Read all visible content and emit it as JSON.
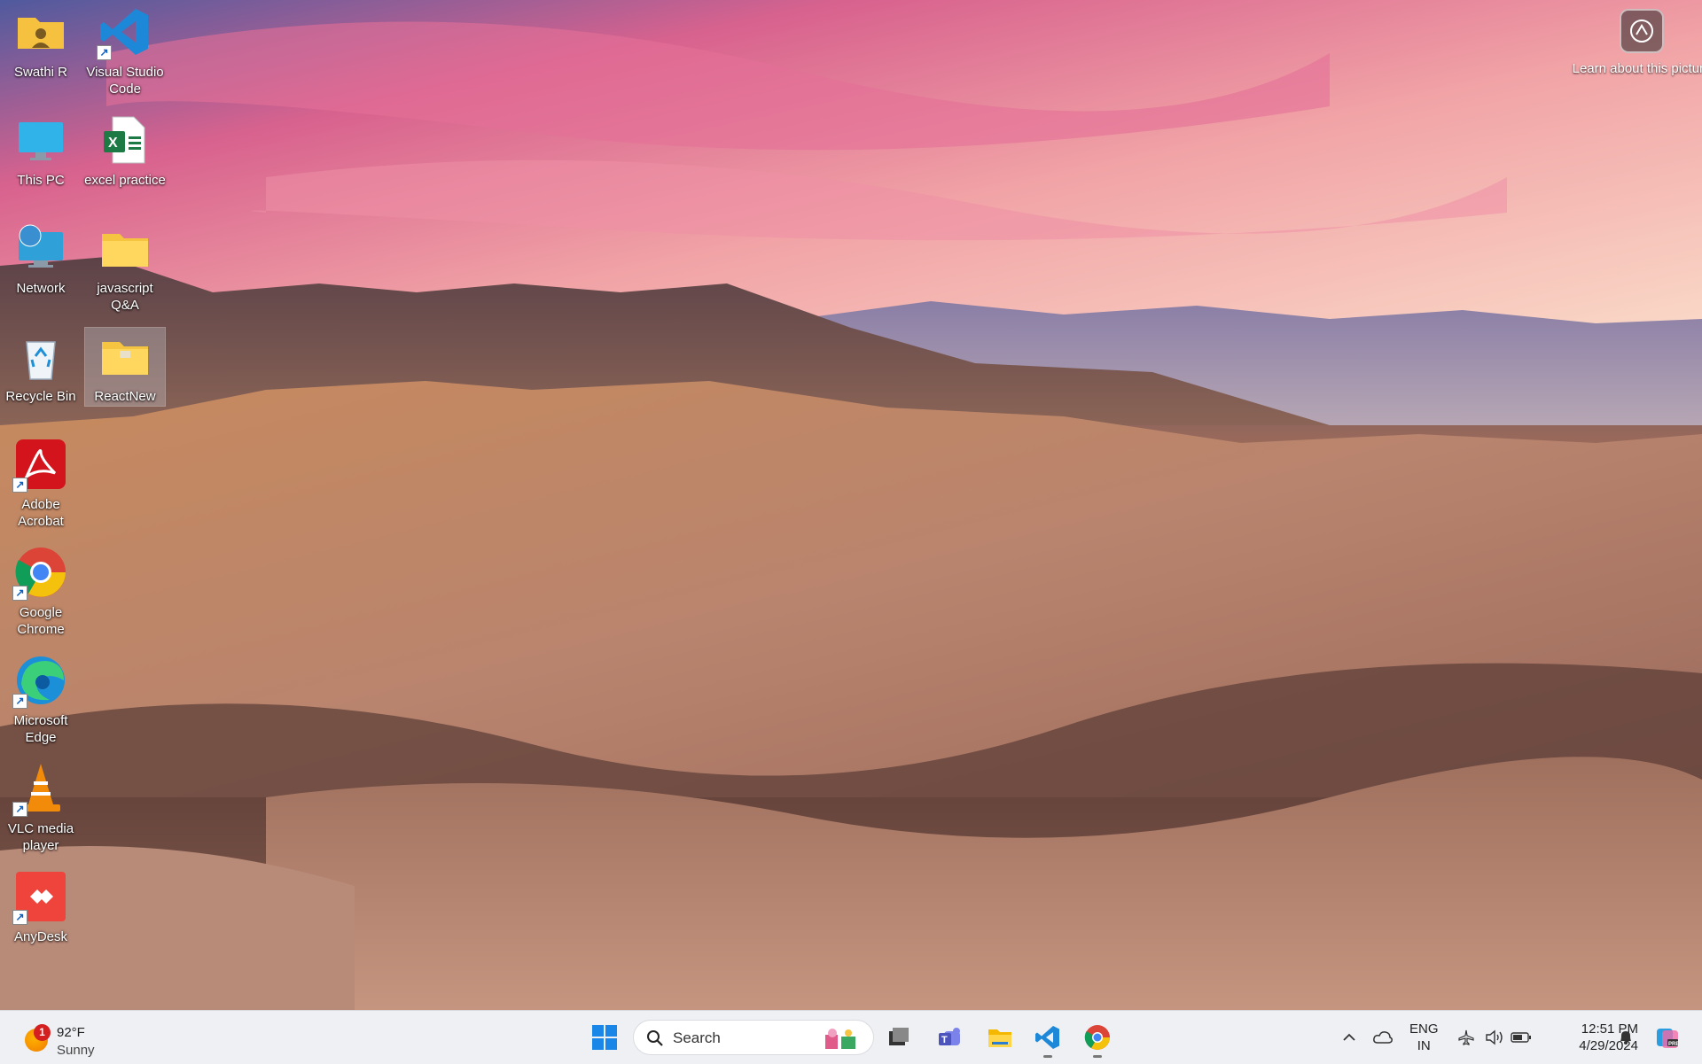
{
  "desktop": {
    "icons": [
      {
        "label": "Swathi R",
        "icon": "user-folder-icon"
      },
      {
        "label": "Visual Studio Code",
        "icon": "vscode-icon"
      },
      {
        "label": "This PC",
        "icon": "monitor-icon"
      },
      {
        "label": "excel practice",
        "icon": "excel-icon"
      },
      {
        "label": "Network",
        "icon": "network-icon"
      },
      {
        "label": "javascript Q&A",
        "icon": "folder-icon"
      },
      {
        "label": "Recycle Bin",
        "icon": "recycle-bin-icon"
      },
      {
        "label": "ReactNew",
        "icon": "folder-icon"
      },
      {
        "label": "Adobe Acrobat",
        "icon": "acrobat-icon"
      },
      {
        "label": "Google Chrome",
        "icon": "chrome-icon"
      },
      {
        "label": "Microsoft Edge",
        "icon": "edge-icon"
      },
      {
        "label": "VLC media player",
        "icon": "vlc-icon"
      },
      {
        "label": "AnyDesk",
        "icon": "anydesk-icon"
      }
    ],
    "learn_about": "Learn about this picture"
  },
  "taskbar": {
    "weather": {
      "badge": "1",
      "temp": "92°F",
      "condition": "Sunny"
    },
    "search_placeholder": "Search",
    "language": {
      "line1": "ENG",
      "line2": "IN"
    },
    "clock": {
      "time": "12:51 PM",
      "date": "4/29/2024"
    },
    "apps": [
      "start-icon",
      "task-view-icon",
      "teams-icon",
      "file-explorer-icon",
      "vscode-icon",
      "chrome-icon"
    ]
  }
}
